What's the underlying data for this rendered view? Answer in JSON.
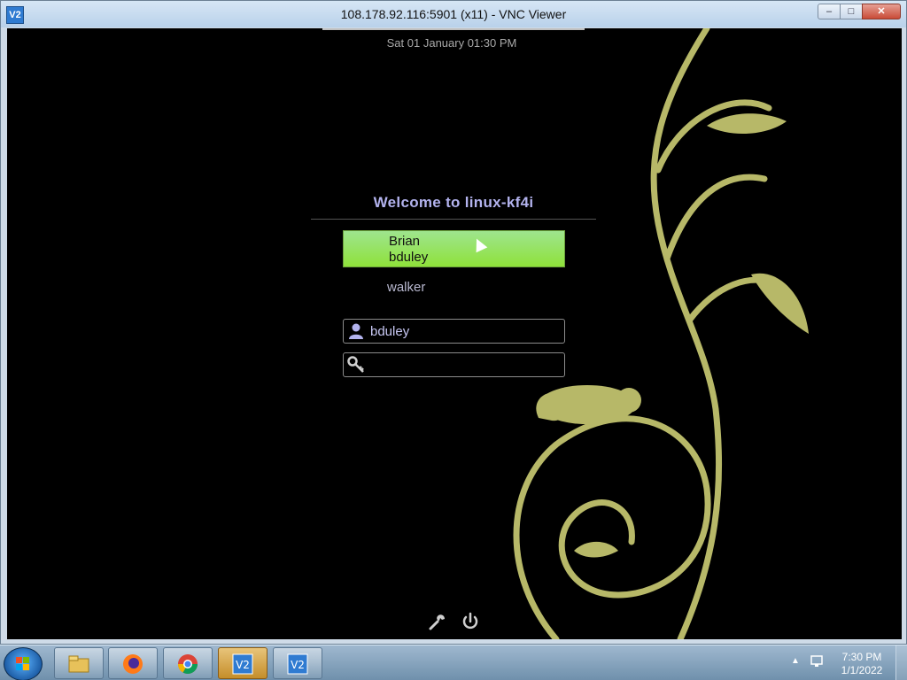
{
  "window": {
    "title": "108.178.92.116:5901 (x11) - VNC Viewer",
    "app_icon": "vnc-viewer-icon",
    "app_icon_text": "V2",
    "controls": {
      "minimize": "–",
      "maximize": "□",
      "close": "✕"
    }
  },
  "greeter": {
    "datetime": "Sat 01 January 01:30 PM",
    "welcome": "Welcome to linux-kf4i",
    "users": [
      {
        "name": "Brian",
        "login": "bduley",
        "selected": true
      },
      {
        "name": "walker",
        "selected": false
      }
    ],
    "username_value": "bduley",
    "password_value": "",
    "icons": [
      "user-icon",
      "key-icon",
      "wrench-icon",
      "power-icon"
    ],
    "accent_color": "#8fe23a",
    "vine_color": "#b7b868"
  },
  "taskbar": {
    "buttons": [
      "file-explorer-icon",
      "firefox-icon",
      "chrome-icon",
      "vnc-viewer-icon",
      "vnc-viewer-icon"
    ],
    "clock_time": "7:30 PM",
    "clock_date": "1/1/2022"
  }
}
